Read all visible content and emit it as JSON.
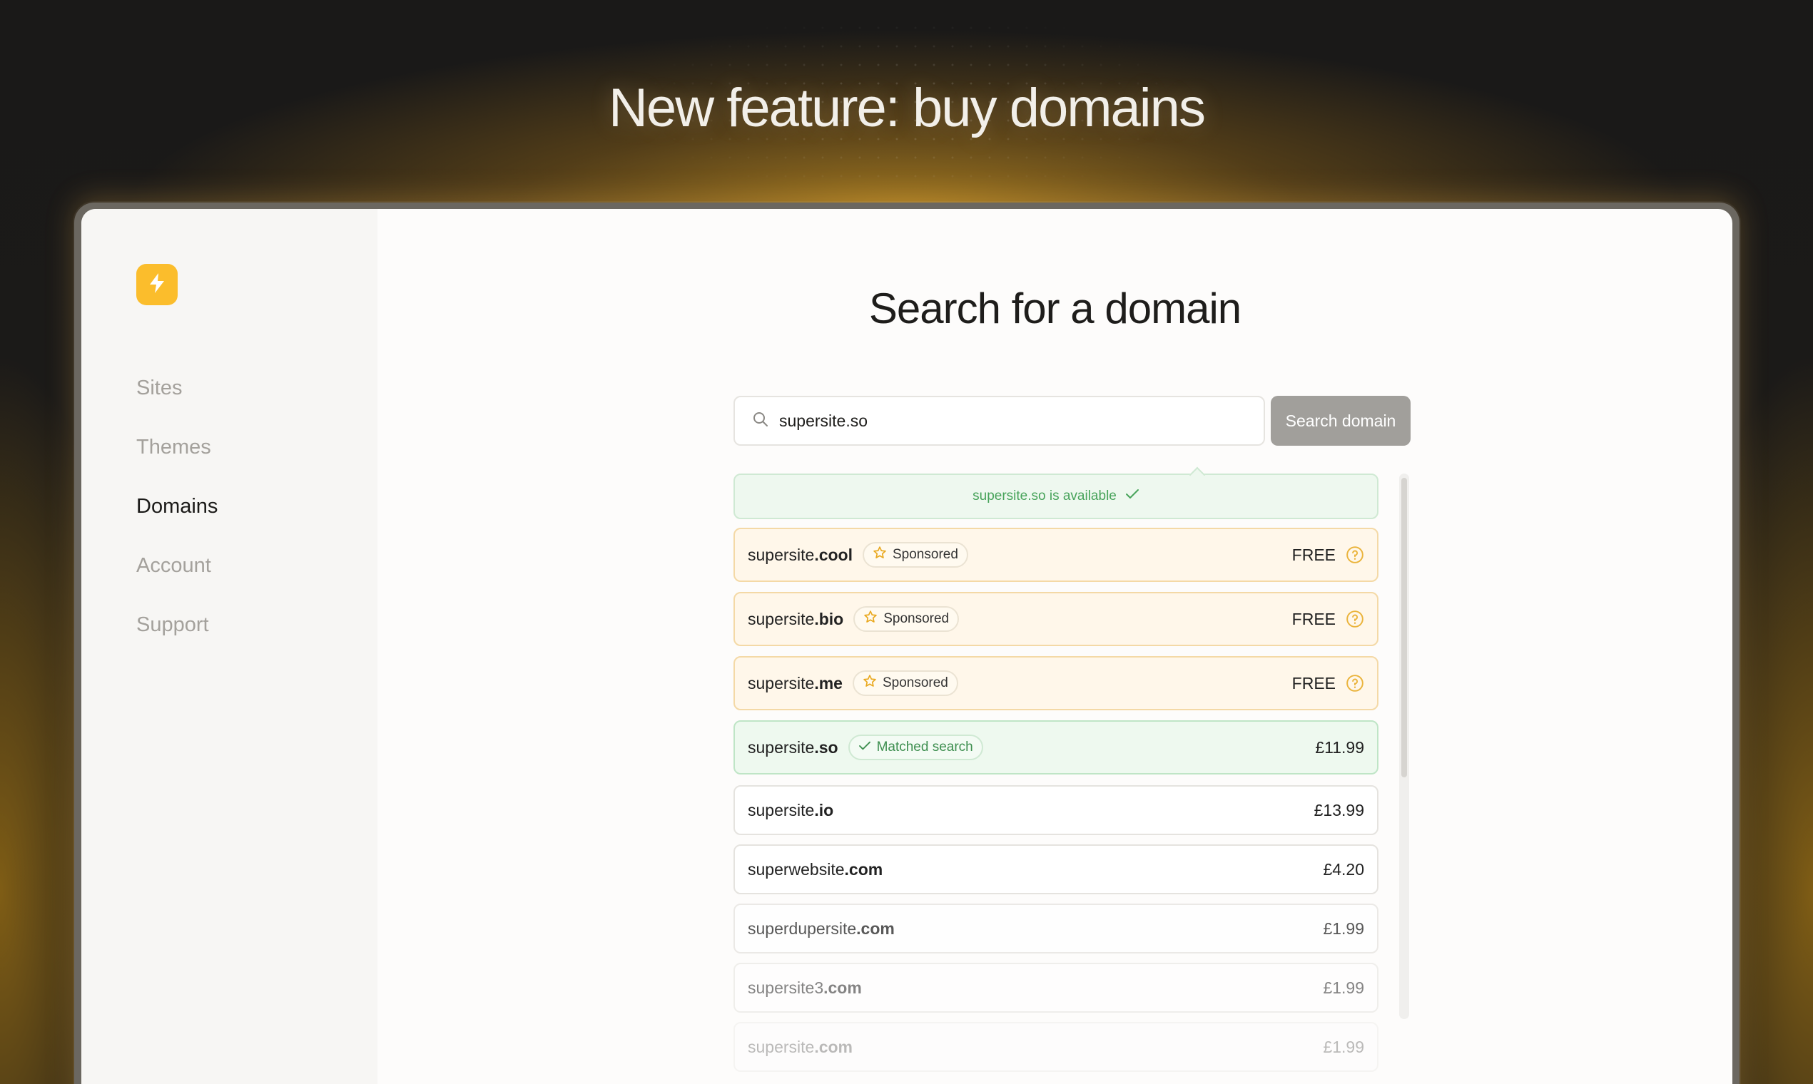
{
  "headline": "New feature: buy domains",
  "sidebar": {
    "items": [
      {
        "label": "Sites"
      },
      {
        "label": "Themes"
      },
      {
        "label": "Domains"
      },
      {
        "label": "Account"
      },
      {
        "label": "Support"
      }
    ],
    "active": "Domains"
  },
  "main": {
    "title": "Search for a domain",
    "search": {
      "value": "supersite.so",
      "button_label": "Search domain"
    },
    "availability": {
      "text": "supersite.so is available"
    },
    "results": [
      {
        "name": "supersite",
        "tld": ".cool",
        "badge": "Sponsored",
        "price": "FREE"
      },
      {
        "name": "supersite",
        "tld": ".bio",
        "badge": "Sponsored",
        "price": "FREE"
      },
      {
        "name": "supersite",
        "tld": ".me",
        "badge": "Sponsored",
        "price": "FREE"
      },
      {
        "name": "supersite",
        "tld": ".so",
        "badge": "Matched search",
        "price": "£11.99"
      },
      {
        "name": "supersite",
        "tld": ".io",
        "price": "£13.99"
      },
      {
        "name": "superwebsite",
        "tld": ".com",
        "price": "£4.20"
      },
      {
        "name": "superdupersite",
        "tld": ".com",
        "price": "£1.99"
      },
      {
        "name": "supersite3",
        "tld": ".com",
        "price": "£1.99"
      },
      {
        "name": "supersite",
        "tld": ".com",
        "price": "£1.99"
      }
    ]
  },
  "colors": {
    "accent": "#fbbd2c",
    "success": "#47a35a",
    "sponsored_bg": "#fff7ea",
    "matched_bg": "#eef9ef"
  },
  "icons": [
    "lightning-icon",
    "search-icon",
    "check-icon",
    "star-icon",
    "help-circle-icon"
  ]
}
